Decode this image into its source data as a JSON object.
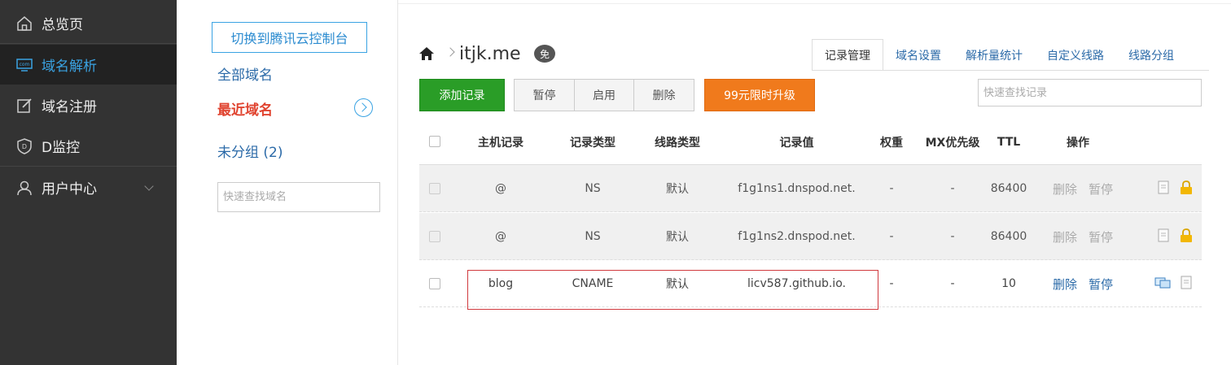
{
  "sidebar": {
    "items": [
      {
        "label": "总览页",
        "icon": "home-icon"
      },
      {
        "label": "域名解析",
        "icon": "dns-icon"
      },
      {
        "label": "域名注册",
        "icon": "edit-icon"
      },
      {
        "label": "D监控",
        "icon": "shield-icon"
      },
      {
        "label": "用户中心",
        "icon": "user-icon"
      }
    ]
  },
  "domains": {
    "switch_label": "切换到腾讯云控制台",
    "all": "全部域名",
    "recent": "最近域名",
    "ungrouped": "未分组 (2)",
    "search_placeholder": "快速查找域名"
  },
  "header": {
    "domain": "itjk.me",
    "badge": "免"
  },
  "tabs": [
    "记录管理",
    "域名设置",
    "解析量统计",
    "自定义线路",
    "线路分组"
  ],
  "toolbar": {
    "add": "添加记录",
    "pause": "暂停",
    "enable": "启用",
    "delete": "删除",
    "upgrade": "99元限时升级",
    "search_placeholder": "快速查找记录"
  },
  "table": {
    "columns": [
      "主机记录",
      "记录类型",
      "线路类型",
      "记录值",
      "权重",
      "MX优先级",
      "TTL",
      "操作"
    ],
    "rows": [
      {
        "host": "@",
        "type": "NS",
        "line": "默认",
        "value": "f1g1ns1.dnspod.net.",
        "weight": "-",
        "mx": "-",
        "ttl": "86400",
        "del": "删除",
        "pause": "暂停"
      },
      {
        "host": "@",
        "type": "NS",
        "line": "默认",
        "value": "f1g1ns2.dnspod.net.",
        "weight": "-",
        "mx": "-",
        "ttl": "86400",
        "del": "删除",
        "pause": "暂停"
      },
      {
        "host": "blog",
        "type": "CNAME",
        "line": "默认",
        "value": "licv587.github.io.",
        "weight": "-",
        "mx": "-",
        "ttl": "10",
        "del": "删除",
        "pause": "暂停"
      }
    ]
  },
  "colors": {
    "sidebar_bg": "#333333",
    "accent_blue": "#3aa3e3",
    "add_green": "#2a9d27",
    "upgrade_orange": "#f07a1c",
    "recent_red": "#e0432f",
    "highlight_red": "#d0393e"
  }
}
